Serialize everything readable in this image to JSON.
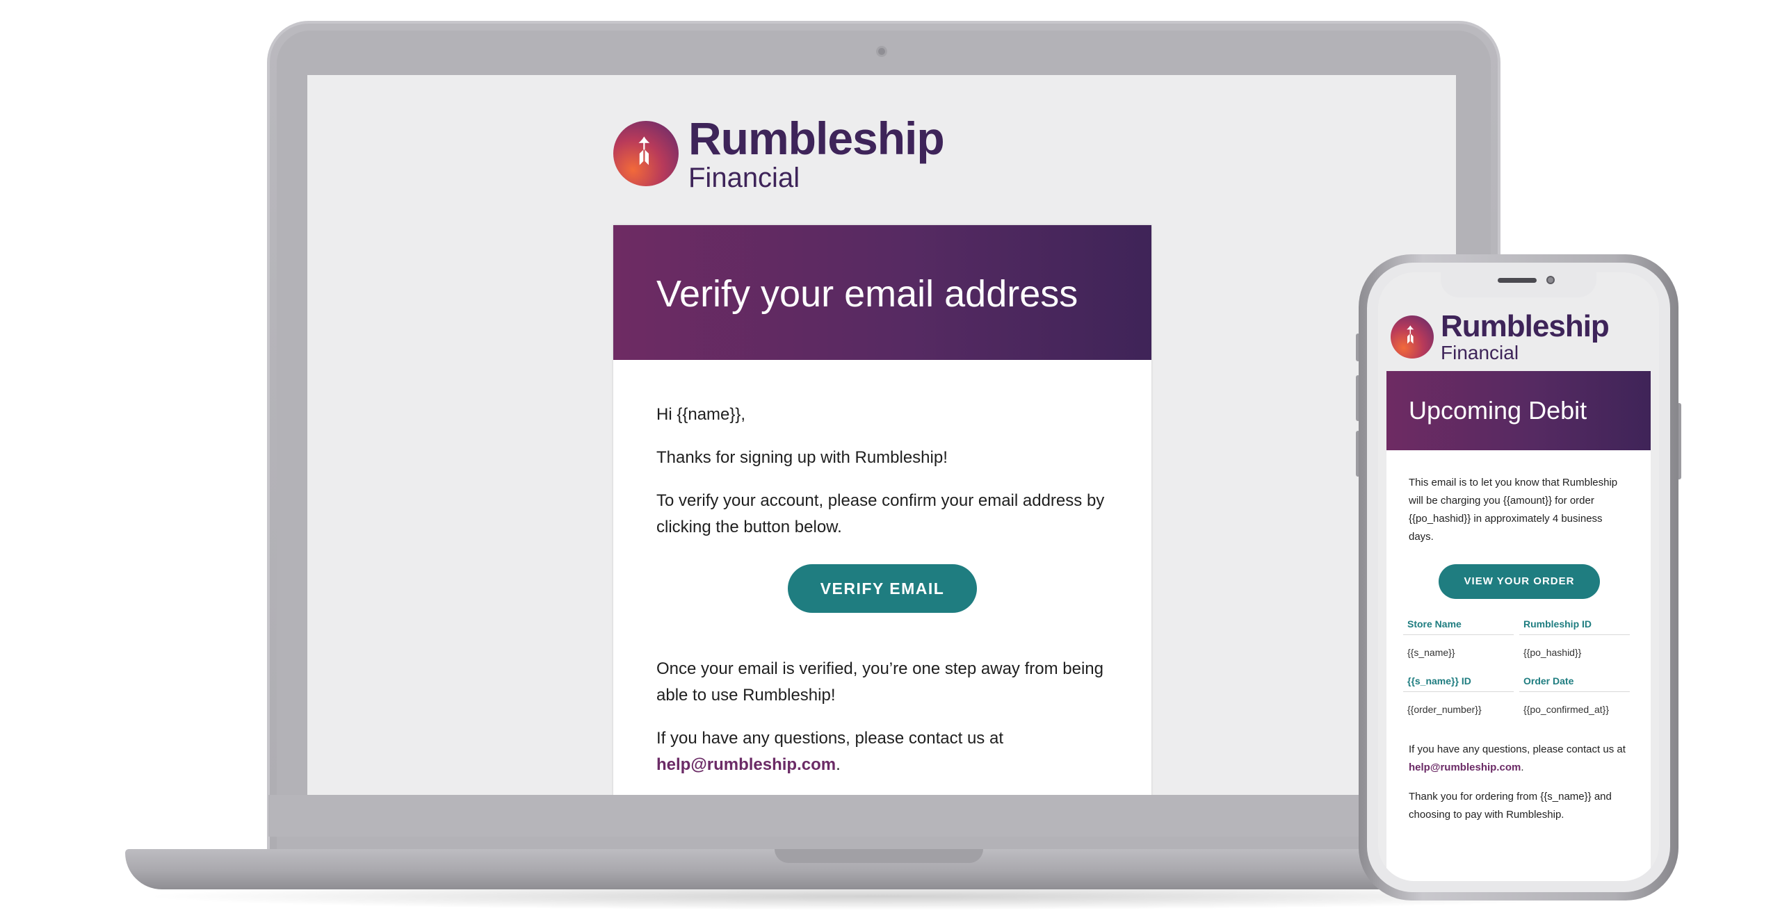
{
  "brand": {
    "name": "Rumbleship",
    "sub": "Financial"
  },
  "laptop_email": {
    "title": "Verify your email address",
    "greeting": "Hi {{name}},",
    "thanks": "Thanks for signing up with Rumbleship!",
    "instruction": "To verify your account, please confirm your email address by clicking the button below.",
    "button": "VERIFY EMAIL",
    "after_verify": "Once your email is verified, you’re one step away from being able to use Rumbleship!",
    "questions_prefix": "If you have any questions, please contact us at",
    "contact_email": "help@rumbleship.com",
    "questions_suffix": "."
  },
  "phone_email": {
    "title": "Upcoming Debit",
    "intro": "This email is to let you know that Rumbleship will be charging you {{amount}} for order {{po_hashid}} in approximately 4 business days.",
    "button": "VIEW YOUR ORDER",
    "table": {
      "store_name_label": "Store Name",
      "store_name_value": "{{s_name}}",
      "rumbleship_id_label": "Rumbleship ID",
      "rumbleship_id_value": "{{po_hashid}}",
      "store_id_label": "{{s_name}} ID",
      "store_id_value": "{{order_number}}",
      "order_date_label": "Order Date",
      "order_date_value": "{{po_confirmed_at}}"
    },
    "questions_prefix": "If you have any questions, please contact us at",
    "contact_email": "help@rumbleship.com",
    "questions_suffix": ".",
    "thanks": "Thank you for ordering from {{s_name}} and choosing to pay with Rumbleship."
  },
  "colors": {
    "purple": "#6e2b63",
    "deep_purple": "#3f2458",
    "teal": "#1f7d80",
    "logo_text": "#3e2459"
  },
  "icons": {
    "logo": "rocket-icon"
  }
}
